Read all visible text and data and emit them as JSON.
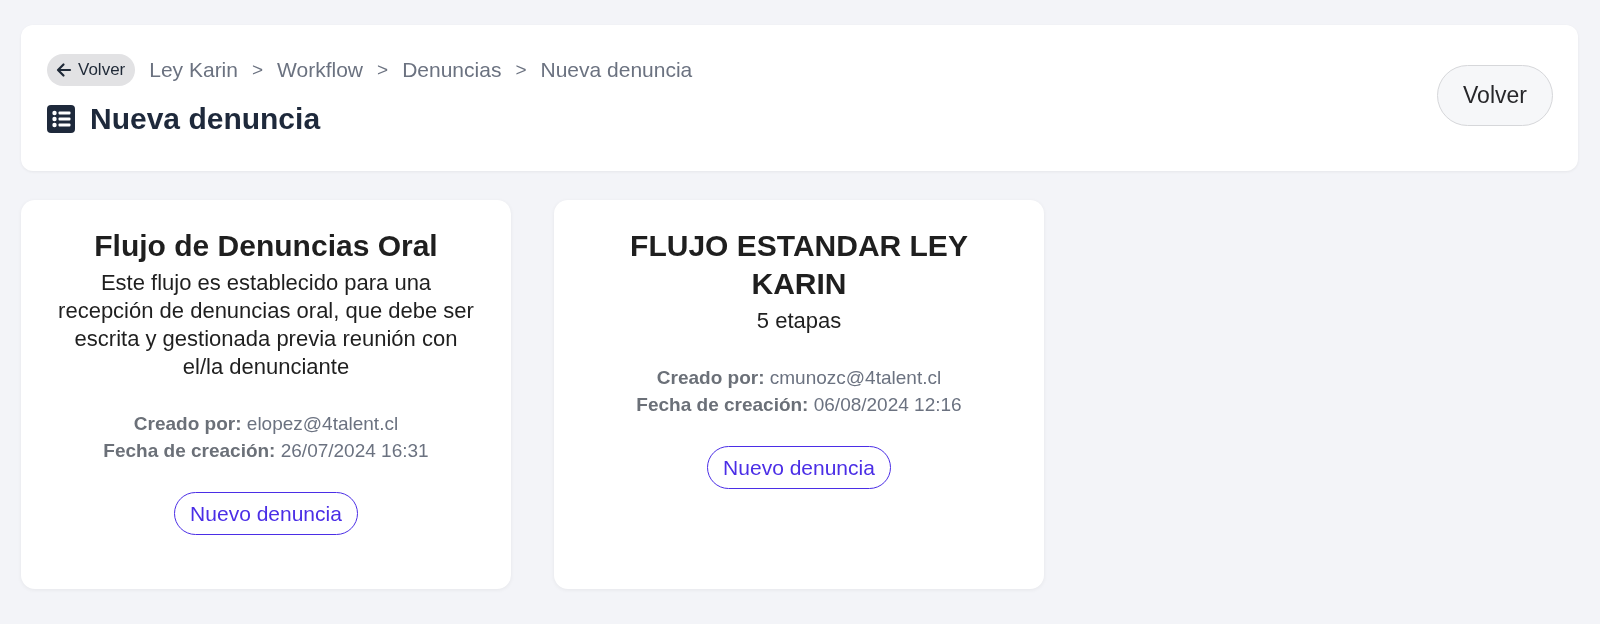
{
  "header": {
    "back_chip": "Volver",
    "breadcrumb": [
      {
        "label": "Ley Karin",
        "separator": ">"
      },
      {
        "label": "Workflow",
        "separator": ">"
      },
      {
        "label": "Denuncias",
        "separator": ">"
      },
      {
        "label": "Nueva denuncia"
      }
    ],
    "title": "Nueva denuncia",
    "back_button": "Volver"
  },
  "flows": [
    {
      "title": "Flujo de Denuncias Oral",
      "description": "Este flujo es establecido para una recepción de denuncias oral, que debe ser escrita y gestionada previa reunión con el/la denunciante",
      "meta": [
        {
          "label": "Creado por:",
          "value": "elopez@4talent.cl"
        },
        {
          "label": "Fecha de creación:",
          "value": "26/07/2024 16:31"
        }
      ],
      "button": "Nuevo denuncia"
    },
    {
      "title": "FLUJO ESTANDAR LEY KARIN",
      "description": "5 etapas",
      "meta": [
        {
          "label": "Creado por:",
          "value": "cmunozc@4talent.cl"
        },
        {
          "label": "Fecha de creación:",
          "value": "06/08/2024 12:16"
        }
      ],
      "button": "Nuevo denuncia"
    }
  ]
}
